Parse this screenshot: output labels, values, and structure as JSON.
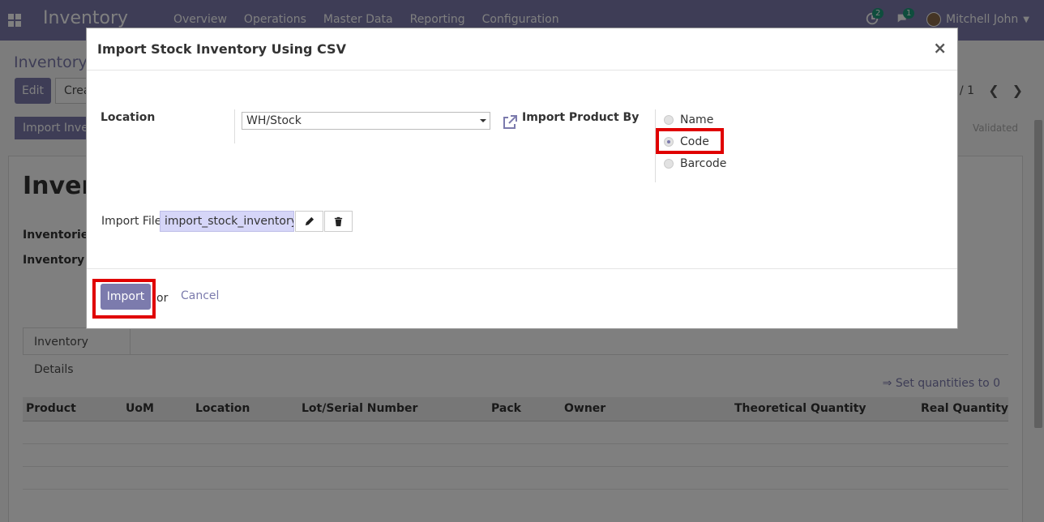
{
  "navbar": {
    "app_title": "Inventory",
    "menu": [
      "Overview",
      "Operations",
      "Master Data",
      "Reporting",
      "Configuration"
    ],
    "activity_count": "2",
    "message_count": "1",
    "user_name": "Mitchell John"
  },
  "background": {
    "breadcrumb": "Inventory",
    "edit_label": "Edit",
    "create_label": "Crea",
    "pager": "/ 1",
    "import_button": "Import Inven",
    "status": "Validated",
    "record_title": "Invent",
    "field1_label": "Inventoried",
    "field2_label": "Inventory of",
    "tab_label": "Inventory Details",
    "set_quantities": "⇒ Set quantities to 0",
    "columns": [
      "Product",
      "UoM",
      "Location",
      "Lot/Serial Number",
      "Pack",
      "Owner",
      "Theoretical Quantity",
      "Real Quantity"
    ]
  },
  "modal": {
    "title": "Import Stock Inventory Using CSV",
    "close_glyph": "×",
    "location_label": "Location",
    "location_value": "WH/Stock",
    "import_by_label": "Import Product By",
    "import_by_options": [
      "Name",
      "Code",
      "Barcode"
    ],
    "import_by_selected": "Code",
    "import_file_label": "Import File",
    "import_file_value": "import_stock_inventory_v",
    "import_button": "Import",
    "or_text": "or",
    "cancel_label": "Cancel"
  },
  "icons": {
    "apps": "apps-grid-icon",
    "activity": "clock-icon",
    "messages": "chat-icon",
    "external": "external-link-icon",
    "edit": "pencil-icon",
    "delete": "trash-icon"
  },
  "colors": {
    "brand": "#7c7bad",
    "highlight": "#e00000",
    "file_field": "#d6d6f8"
  }
}
